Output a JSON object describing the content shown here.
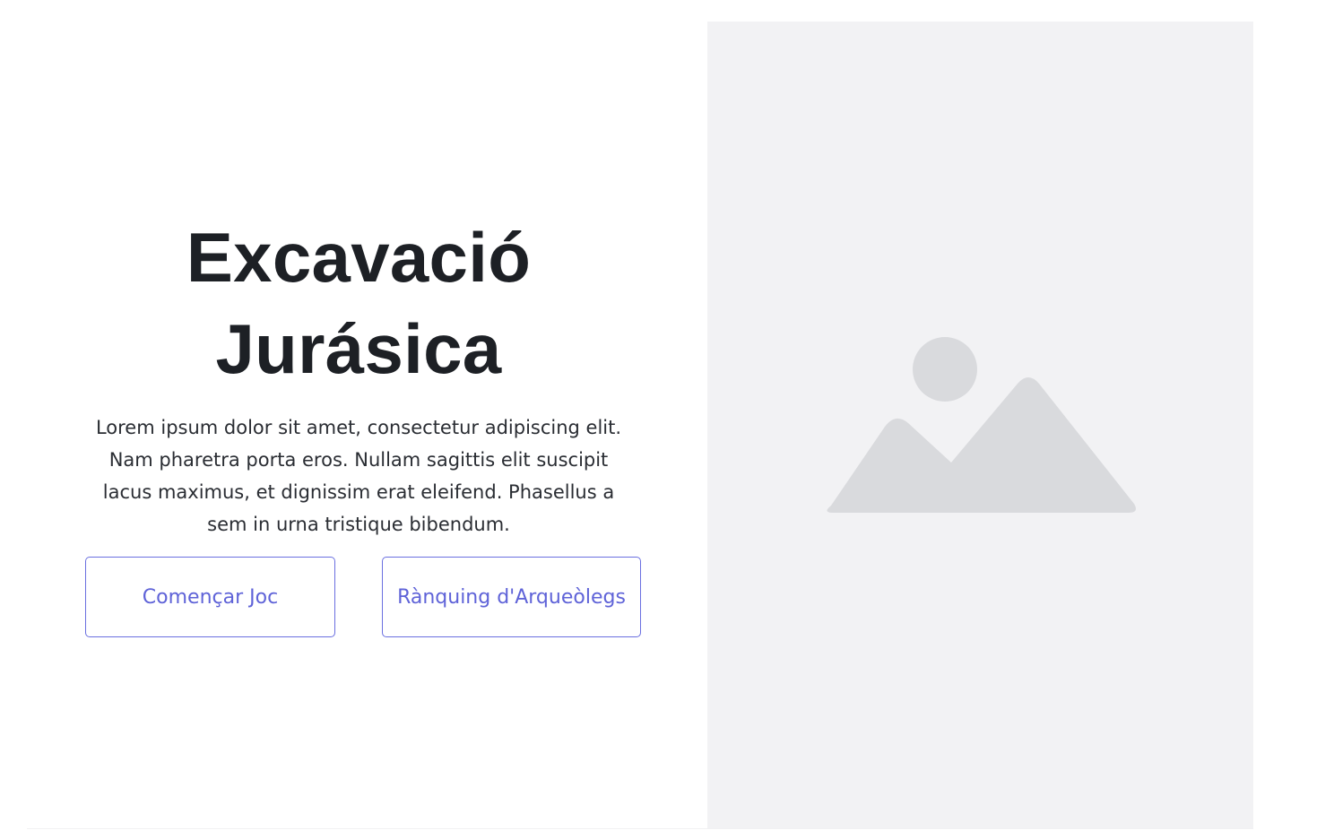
{
  "hero": {
    "title_line1": "Excavació",
    "title_line2": "Jurásica",
    "description": "Lorem ipsum dolor sit amet, consectetur adipiscing elit. Nam pharetra porta eros. Nullam sagittis elit suscipit lacus maximus, et dignissim erat eleifend. Phasellus a sem in urna tristique bibendum."
  },
  "buttons": {
    "start_label": "Començar Joc",
    "ranking_label": "Rànquing d'Arqueòlegs"
  },
  "image": {
    "icon": "image-placeholder-icon"
  },
  "colors": {
    "accent": "#5f63d8",
    "title": "#1d2025",
    "placeholder_bg": "#f2f2f4",
    "placeholder_icon": "#d9dadd"
  }
}
